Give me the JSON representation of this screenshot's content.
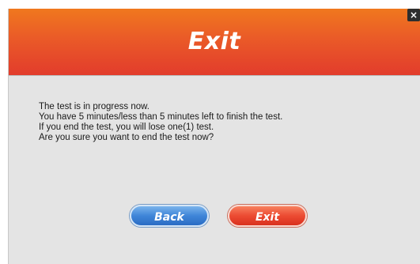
{
  "dialog": {
    "title": "Exit",
    "close_label": "×",
    "message_lines": [
      "The test is in progress now.",
      "You have 5 minutes/less than 5 minutes left to finish the test.",
      "If you end the test, you will lose one(1) test.",
      "Are you sure you want to end the test now?"
    ],
    "back_label": "Back",
    "exit_label": "Exit"
  },
  "colors": {
    "header_top": "#f0781e",
    "header_bottom": "#e23c2c",
    "back_button": "#3f85d8",
    "exit_button": "#ec4b32",
    "body_background": "#e4e4e4"
  },
  "icons": {
    "close": "close-icon"
  }
}
